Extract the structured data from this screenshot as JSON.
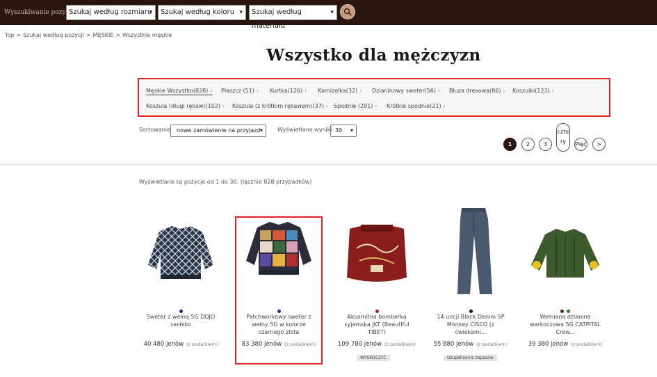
{
  "topbar": {
    "label": "Wyszukiwanie pozycji",
    "selects": [
      {
        "value": "Szukaj według rozmiaru"
      },
      {
        "value": "Szukaj według koloru"
      },
      {
        "value": "Szukaj według materiału"
      }
    ],
    "search_icon": "search-icon"
  },
  "breadcrumb": [
    "Top",
    ">",
    "Szukaj według pozycji",
    ">",
    "MĘSKIE",
    ">",
    "Wszystkie męskie"
  ],
  "title": "Wszystko dla mężczyzn",
  "categories": [
    {
      "label": "Męskie Wszystko(828)",
      "active": true
    },
    {
      "label": "Płaszcz (51)"
    },
    {
      "label": "Kurtka(126)"
    },
    {
      "label": "Kamizelka(32)"
    },
    {
      "label": "Dzianinowy sweter(56)"
    },
    {
      "label": "Bluza dresowa(86)"
    },
    {
      "label": "Koszulki(123)"
    },
    {
      "label": "Koszula (długi rękaw)(102)"
    },
    {
      "label": "Koszula (z krótkim rękawem)(37)"
    },
    {
      "label": "Spodnie (201)"
    },
    {
      "label": "Krótkie spodnie(21)"
    }
  ],
  "sort": {
    "label": "Sortowanie",
    "value": "nowe zamówienie na przyjazd"
  },
  "per_page": {
    "label": "Wyświetlane wyniki",
    "value": "30"
  },
  "pagination": {
    "pages": [
      "1",
      "2",
      "3",
      "czte ry",
      "Pięć"
    ],
    "current": "1",
    "next": ">"
  },
  "result_count": "Wyświetlane są pozycje od 1 do 30. (łącznie 828 przypadków)",
  "products": [
    {
      "name": "Sweter z wełną 5G DOJO sashiko",
      "price": "40 480 jenów",
      "tax": "(z podatkiem)",
      "colors": [
        "#1b2f8a"
      ],
      "badge": ""
    },
    {
      "name": "Patchworkowy sweter z wełny 5G w kolorze czarnego złota",
      "price": "83 380 jenów",
      "tax": "(z podatkiem)",
      "colors": [
        "#1b2f8a"
      ],
      "badge": ""
    },
    {
      "name": "Aksamitna bomberka syjamska JKT (Beautiful TIBET)",
      "price": "109 780 jenów",
      "tax": "(z podatkiem)",
      "colors": [
        "#b21c1c"
      ],
      "badge": "WYSKOCZYĆ"
    },
    {
      "name": "14 uncji Black Denim 5P Monkey CISCO (z ćwiekami...",
      "price": "55 880 jenów",
      "tax": "(z podatkiem)",
      "colors": [
        "#111111"
      ],
      "badge": "Uzupełnianie zapasów"
    },
    {
      "name": "Wełniana dzianina warkoczowa 5G CATPITAL Crew...",
      "price": "39 380 jenów",
      "tax": "(z podatkiem)",
      "colors": [
        "#3b2a22",
        "#3a7a3a"
      ],
      "badge": ""
    }
  ]
}
